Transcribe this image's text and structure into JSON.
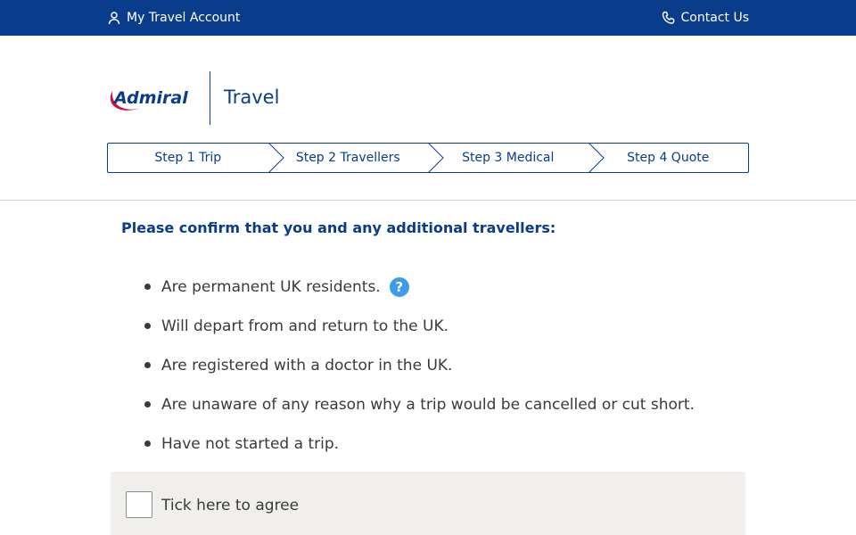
{
  "topbar": {
    "account_label": "My Travel Account",
    "contact_label": "Contact Us",
    "background": "#0a3c8c"
  },
  "header": {
    "logo_text": "Admiral",
    "title": "Travel"
  },
  "steps": [
    {
      "label": "Step 1 Trip"
    },
    {
      "label": "Step 2 Travellers"
    },
    {
      "label": "Step 3 Medical"
    },
    {
      "label": "Step 4 Quote"
    }
  ],
  "main": {
    "heading": "Please confirm that you and any additional travellers:",
    "bullets": [
      "Are permanent UK residents.",
      "Will depart from and return to the UK.",
      "Are registered with a doctor in the UK.",
      "Are unaware of any reason why a trip would be cancelled or cut short.",
      "Have not started a trip."
    ],
    "help_icon_glyph": "?"
  },
  "agree": {
    "label": "Tick here to agree"
  },
  "icons": {
    "account": "user-icon",
    "contact": "phone-icon",
    "help": "question-circle-icon"
  },
  "colors": {
    "brand_blue": "#0a3c8c",
    "help_blue": "#3d9be9",
    "agree_bg": "#f0efeb",
    "logo_red": "#d0103a"
  }
}
